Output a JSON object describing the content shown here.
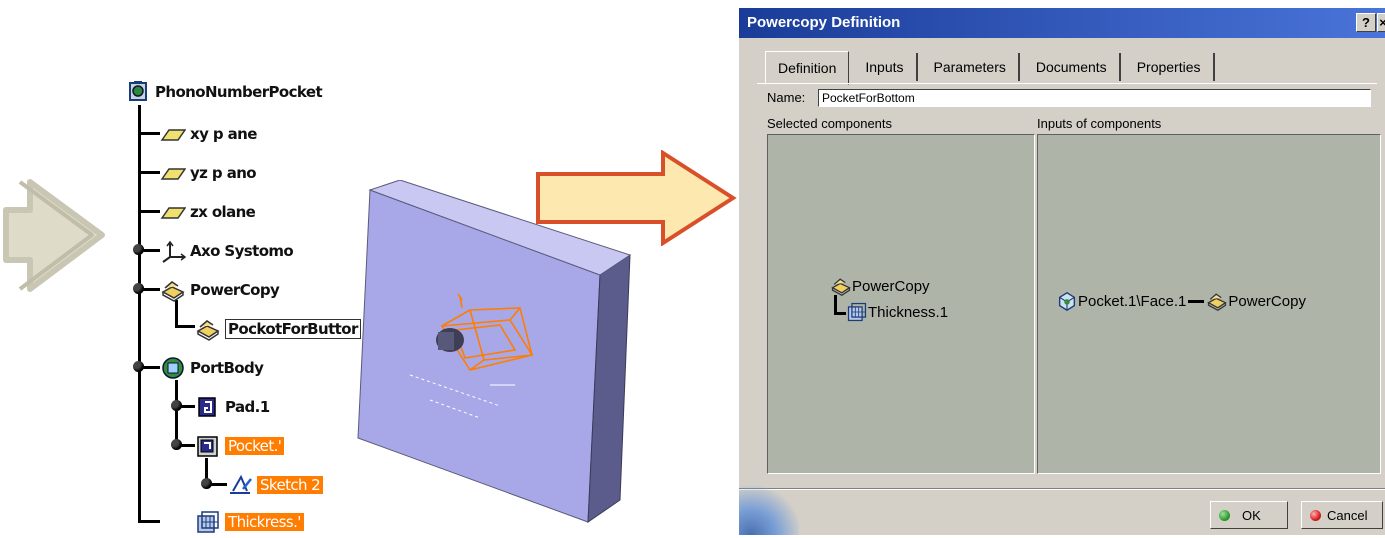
{
  "tree": {
    "root": "PhonoNumberPocket",
    "items": [
      {
        "label": "xy p ane"
      },
      {
        "label": "yz p ano"
      },
      {
        "label": "zx olane"
      },
      {
        "label": "Axo Systomo"
      },
      {
        "label": "PowerCopy"
      },
      {
        "label": "PockotForButtor"
      },
      {
        "label": "PortBody"
      },
      {
        "label": "Pad.1"
      },
      {
        "label": "Pocket.'"
      },
      {
        "label": "Sketch 2"
      },
      {
        "label": "Thickress.'"
      }
    ]
  },
  "dialog": {
    "title": "Powercopy Definition",
    "help_label": "?",
    "close_label": "×",
    "tabs": [
      "Definition",
      "Inputs",
      "Parameters",
      "Documents",
      "Properties"
    ],
    "active_tab": "Definition",
    "name_label": "Name:",
    "name_value": "PocketForBottom",
    "selected_components_label": "Selected components",
    "inputs_of_components_label": "Inputs of components",
    "selected_tree": {
      "root": "PowerCopy",
      "child": "Thickness.1"
    },
    "inputs": {
      "input": "Pocket.1\\Face.1",
      "target": "PowerCopy"
    },
    "ok_label": "OK",
    "cancel_label": "Cancel"
  },
  "colors": {
    "selection": "#ff7d00",
    "title_bar_start": "#1a3c99",
    "title_bar_end": "#4a74d9",
    "panel_bg": "#aeb4a8",
    "dialog_bg": "#d4d0c8",
    "ok_dot": "#2f9e2f",
    "cancel_dot": "#d42020",
    "model_face": "#a8a8e8",
    "model_outline": "#ff7d00",
    "arrow_fill": "#fde9b0",
    "arrow_stroke": "#d8502a"
  },
  "icons": [
    "root-product-icon",
    "plane-icon",
    "axis-system-icon",
    "powercopy-icon",
    "body-icon",
    "pad-icon",
    "pocket-icon",
    "sketch-icon",
    "thickness-icon",
    "face-icon"
  ]
}
